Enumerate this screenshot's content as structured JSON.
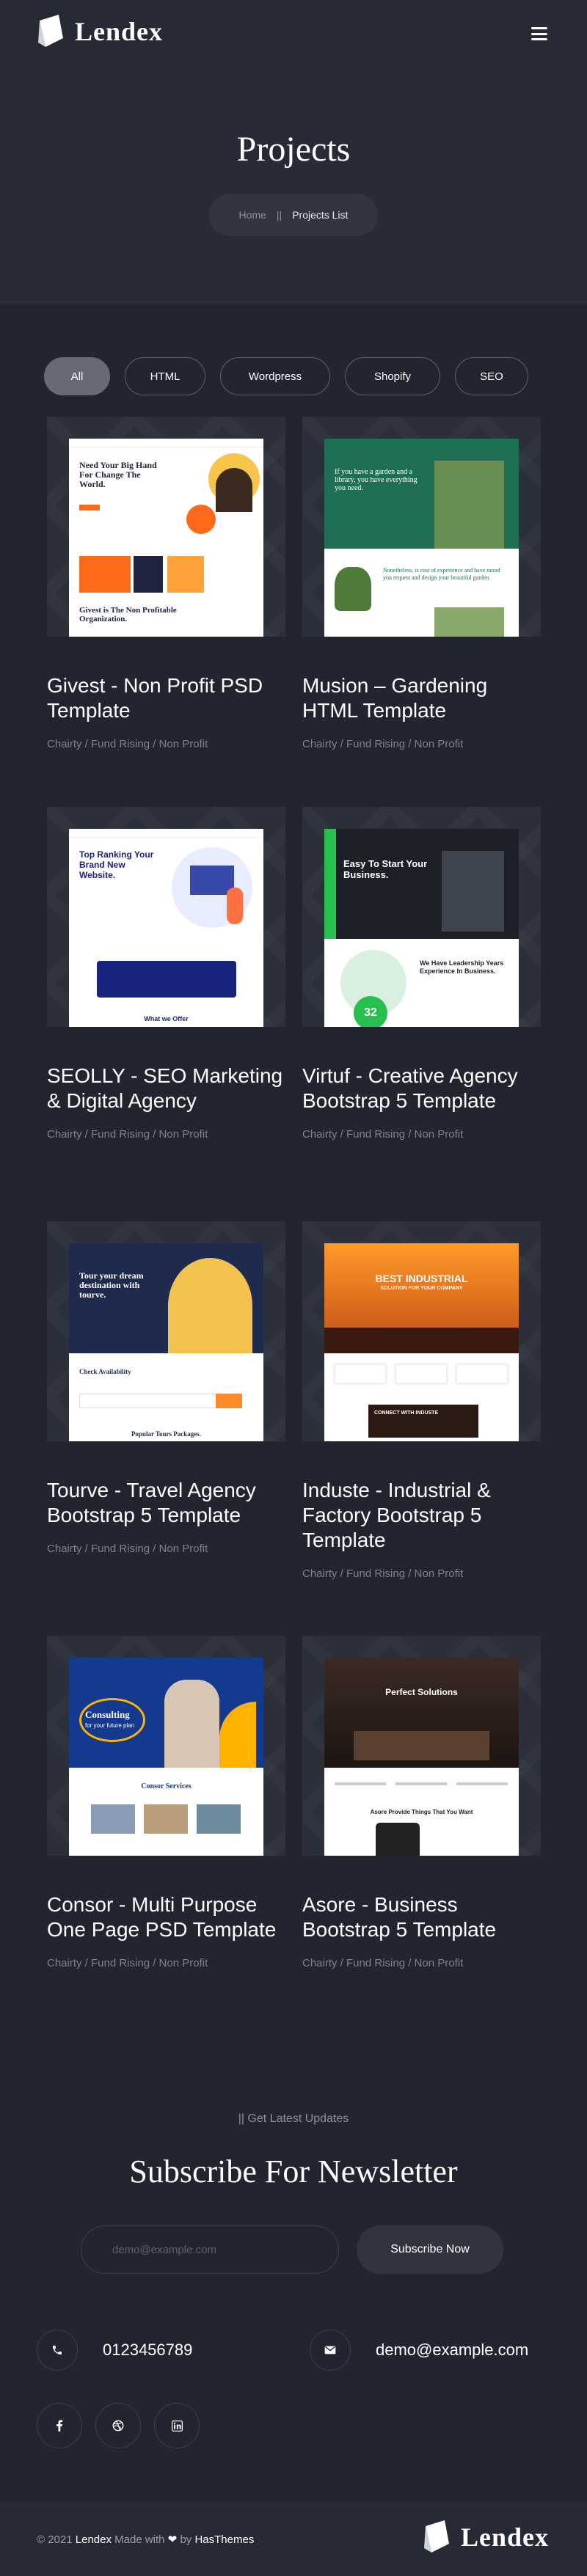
{
  "brand": {
    "name": "Lendex"
  },
  "hero": {
    "title": "Projects",
    "breadcrumb": {
      "home": "Home",
      "separator": "||",
      "current": "Projects List"
    }
  },
  "filters": [
    {
      "label": "All",
      "active": true
    },
    {
      "label": "HTML",
      "active": false
    },
    {
      "label": "Wordpress",
      "active": false
    },
    {
      "label": "Shopify",
      "active": false
    },
    {
      "label": "SEO",
      "active": false
    }
  ],
  "projects": [
    {
      "title": "Givest - Non Profit PSD Template",
      "tags": "Chairty / Fund Rising / Non Profit"
    },
    {
      "title": "Musion – Gardening HTML Template",
      "tags": "Chairty / Fund Rising / Non Profit"
    },
    {
      "title": "SEOLLY - SEO Marketing & Digital Agency",
      "tags": "Chairty / Fund Rising / Non Profit"
    },
    {
      "title": "Virtuf - Creative Agency Bootstrap 5 Template",
      "tags": "Chairty / Fund Rising / Non Profit"
    },
    {
      "title": "Tourve - Travel Agency Bootstrap 5 Template",
      "tags": "Chairty / Fund Rising / Non Profit"
    },
    {
      "title": "Induste - Industrial & Factory Bootstrap 5 Template",
      "tags": "Chairty / Fund Rising / Non Profit"
    },
    {
      "title": "Consor - Multi Purpose One Page PSD Template",
      "tags": "Chairty / Fund Rising / Non Profit"
    },
    {
      "title": "Asore - Business Bootstrap 5 Template",
      "tags": "Chairty / Fund Rising / Non Profit"
    }
  ],
  "thumbs": {
    "givest": {
      "headline": "Need Your Big Hand For Change The World.",
      "tagline": "Givest is The Non Profitable Organization."
    },
    "musion": {
      "headline": "If you have a garden and a library, you have everything you need.",
      "sub": "Nonetheless, is cost of experience and have mood you request and design your beautiful garden."
    },
    "seolly": {
      "headline": "Top Ranking Your Brand New Website.",
      "foot": "What we Offer"
    },
    "virtuf": {
      "headline": "Easy To Start Your Business.",
      "badge": "32",
      "side": "We Have Leadership Years Experience In Business."
    },
    "tourve": {
      "headline": "Tour your dream destination with tourve.",
      "check": "Check Availability",
      "foot": "Popular Tours Packages."
    },
    "induste": {
      "headline": "BEST INDUSTRIAL",
      "sub": "SOLUTION FOR YOUR COMPANY",
      "foot": "CONNECT WITH INDUSTE"
    },
    "consor": {
      "headline": "Consulting",
      "sub": "for your future plan",
      "foot": "Consor Services"
    },
    "asore": {
      "headline": "Perfect Solutions",
      "foot": "Asore Provide Things That You Want"
    }
  },
  "newsletter": {
    "sub": "||  Get Latest Updates",
    "title": "Subscribe For Newsletter",
    "placeholder": "demo@example.com",
    "button": "Subscribe Now"
  },
  "contact": {
    "phone": "0123456789",
    "email": "demo@example.com"
  },
  "footer": {
    "copy_prefix": "© 2021",
    "brand": "Lendex",
    "made_with": "Made with",
    "by": "by",
    "author": "HasThemes"
  },
  "colors": {
    "bg": "#22252f",
    "header": "#262a35",
    "accent": "#ff6a1a",
    "text_muted": "#7d818b"
  }
}
